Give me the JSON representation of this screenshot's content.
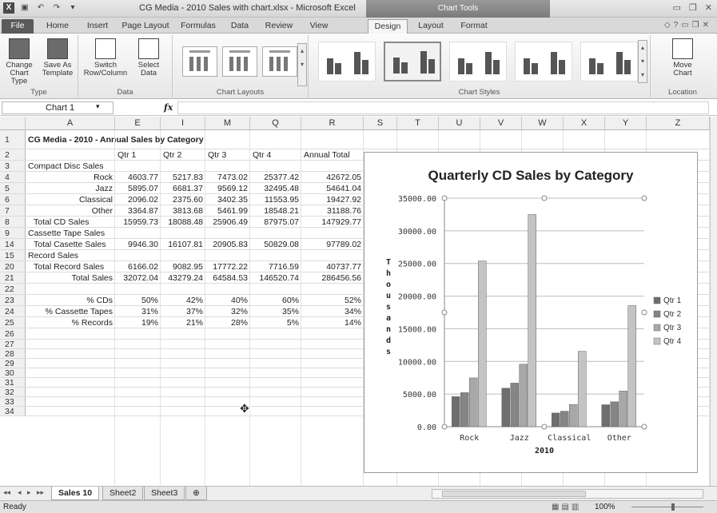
{
  "window": {
    "title": "CG Media - 2010 Sales with chart.xlsx  -  Microsoft Excel",
    "context_tab_group": "Chart Tools"
  },
  "tabs": [
    "File",
    "Home",
    "Insert",
    "Page Layout",
    "Formulas",
    "Data",
    "Review",
    "View",
    "Design",
    "Layout",
    "Format"
  ],
  "active_tab": "Design",
  "ribbon": {
    "type_group": {
      "label": "Type",
      "buttons": [
        "Change Chart Type",
        "Save As Template"
      ]
    },
    "data_group": {
      "label": "Data",
      "buttons": [
        "Switch Row/Column",
        "Select Data"
      ]
    },
    "layouts_group": {
      "label": "Chart Layouts"
    },
    "styles_group": {
      "label": "Chart Styles"
    },
    "location_group": {
      "label": "Location",
      "buttons": [
        "Move Chart"
      ]
    },
    "move_chart_label_1": "Move",
    "move_chart_label_2": "Chart",
    "change_type_1": "Change",
    "change_type_2": "Chart Type",
    "save_template_1": "Save As",
    "save_template_2": "Template",
    "switch_1": "Switch",
    "switch_2": "Row/Column",
    "select_1": "Select",
    "select_2": "Data"
  },
  "formula_bar": {
    "name_box": "Chart 1",
    "fx": "fx",
    "formula": ""
  },
  "columns": [
    "A",
    "E",
    "I",
    "M",
    "Q",
    "R",
    "S",
    "T",
    "U",
    "V",
    "W",
    "X",
    "Y",
    "Z"
  ],
  "rows": [
    {
      "n": "1",
      "A": "CG Media - 2010 - Annual Sales by Category",
      "bold": true
    },
    {
      "n": "2",
      "E": "Qtr 1",
      "I": "Qtr 2",
      "M": "Qtr 3",
      "Q": "Qtr 4",
      "R": "Annual Total"
    },
    {
      "n": "3",
      "A": "Compact Disc Sales"
    },
    {
      "n": "4",
      "A": "Rock",
      "E": "4603.77",
      "I": "5217.83",
      "M": "7473.02",
      "Q": "25377.42",
      "R": "42672.05",
      "ar": true
    },
    {
      "n": "5",
      "A": "Jazz",
      "E": "5895.07",
      "I": "6681.37",
      "M": "9569.12",
      "Q": "32495.48",
      "R": "54641.04",
      "ar": true
    },
    {
      "n": "6",
      "A": "Classical",
      "E": "2096.02",
      "I": "2375.60",
      "M": "3402.35",
      "Q": "11553.95",
      "R": "19427.92",
      "ar": true
    },
    {
      "n": "7",
      "A": "Other",
      "E": "3364.87",
      "I": "3813.68",
      "M": "5461.99",
      "Q": "18548.21",
      "R": "31188.76",
      "ar": true
    },
    {
      "n": "8",
      "A": "Total CD Sales",
      "E": "15959.73",
      "I": "18088.48",
      "M": "25906.49",
      "Q": "87975.07",
      "R": "147929.77",
      "ind": true
    },
    {
      "n": "9",
      "A": "Cassette Tape Sales"
    },
    {
      "n": "14",
      "A": "Total Casette Sales",
      "E": "9946.30",
      "I": "16107.81",
      "M": "20905.83",
      "Q": "50829.08",
      "R": "97789.02",
      "ind": true
    },
    {
      "n": "15",
      "A": "Record Sales"
    },
    {
      "n": "20",
      "A": "Total Record Sales",
      "E": "6166.02",
      "I": "9082.95",
      "M": "17772.22",
      "Q": "7716.59",
      "R": "40737.77",
      "ind": true
    },
    {
      "n": "21",
      "A": "Total Sales",
      "E": "32072.04",
      "I": "43279.24",
      "M": "64584.53",
      "Q": "146520.74",
      "R": "286456.56",
      "ar": true
    },
    {
      "n": "22"
    },
    {
      "n": "23",
      "A": "% CDs",
      "E": "50%",
      "I": "42%",
      "M": "40%",
      "Q": "60%",
      "R": "52%",
      "ar": true
    },
    {
      "n": "24",
      "A": "% Cassette Tapes",
      "E": "31%",
      "I": "37%",
      "M": "32%",
      "Q": "35%",
      "R": "34%",
      "ar": true
    },
    {
      "n": "25",
      "A": "% Records",
      "E": "19%",
      "I": "21%",
      "M": "28%",
      "Q": "5%",
      "R": "14%",
      "ar": true
    },
    {
      "n": "26"
    },
    {
      "n": "27"
    },
    {
      "n": "28"
    },
    {
      "n": "29"
    },
    {
      "n": "30"
    },
    {
      "n": "31"
    },
    {
      "n": "32"
    },
    {
      "n": "33"
    },
    {
      "n": "34"
    }
  ],
  "chart_data": {
    "type": "bar",
    "title": "Quarterly CD Sales by Category",
    "xlabel": "2010",
    "ylabel": "Thousands",
    "categories": [
      "Rock",
      "Jazz",
      "Classical",
      "Other"
    ],
    "series": [
      {
        "name": "Qtr 1",
        "values": [
          4603.77,
          5895.07,
          2096.02,
          3364.87
        ],
        "color": "#6e6e6e"
      },
      {
        "name": "Qtr 2",
        "values": [
          5217.83,
          6681.37,
          2375.6,
          3813.68
        ],
        "color": "#858585"
      },
      {
        "name": "Qtr 3",
        "values": [
          7473.02,
          9569.12,
          3402.35,
          5461.99
        ],
        "color": "#a8a8a8"
      },
      {
        "name": "Qtr 4",
        "values": [
          25377.42,
          32495.48,
          11553.95,
          18548.21
        ],
        "color": "#c4c4c4"
      }
    ],
    "ylim": [
      0,
      35000
    ],
    "yticks": [
      "0.00",
      "5000.00",
      "10000.00",
      "15000.00",
      "20000.00",
      "25000.00",
      "30000.00",
      "35000.00"
    ],
    "grid": true,
    "legend": "right"
  },
  "sheet_tabs": [
    "Sales 10",
    "Sheet2",
    "Sheet3"
  ],
  "active_sheet": "Sales 10",
  "status": {
    "ready": "Ready",
    "zoom": "100%"
  }
}
